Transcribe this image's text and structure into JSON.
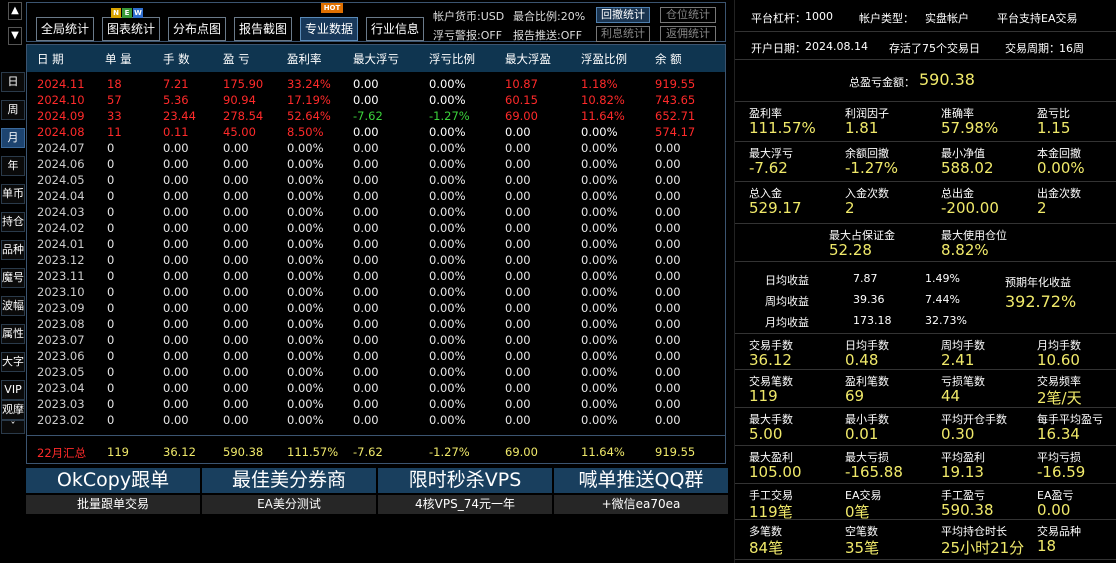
{
  "nav": {
    "up": "▲",
    "down": "▼"
  },
  "side_tabs": [
    "日",
    "周",
    "月",
    "年",
    "单币",
    "持仓",
    "品种",
    "魔号",
    "波幅",
    "属性",
    "大字",
    "VIP",
    "观摩",
    "ˇ"
  ],
  "top_buttons": [
    "全局统计",
    "图表统计",
    "分布点图",
    "报告截图",
    "专业数据",
    "行业信息"
  ],
  "badges": {
    "new": [
      "N",
      "E",
      "W"
    ],
    "hot": "HOT"
  },
  "top_labels": {
    "currency": "帐户货币:USD",
    "max_ratio": "最合比例:20%",
    "float_warn": "浮亏警报:OFF",
    "report_push": "报告推送:OFF"
  },
  "gray_buttons": [
    "回撤统计",
    "仓位统计",
    "利息统计",
    "返佣统计"
  ],
  "colors": {
    "accent": "#f0e96a",
    "red": "#ff2a2a",
    "green": "#3bd33b",
    "header_bg": "#0f3550",
    "ad_bg": "#193f5e"
  },
  "table": {
    "headers": [
      "日 期",
      "单 量",
      "手 数",
      "盈 亏",
      "盈利率",
      "最大浮亏",
      "浮亏比例",
      "最大浮盈",
      "浮盈比例",
      "余 额"
    ],
    "rows": [
      [
        "2024.11",
        "18",
        "7.21",
        "175.90",
        "33.24%",
        "0.00",
        "0.00%",
        "10.87",
        "1.18%",
        "919.55"
      ],
      [
        "2024.10",
        "57",
        "5.36",
        "90.94",
        "17.19%",
        "0.00",
        "0.00%",
        "60.15",
        "10.82%",
        "743.65"
      ],
      [
        "2024.09",
        "33",
        "23.44",
        "278.54",
        "52.64%",
        "-7.62",
        "-1.27%",
        "69.00",
        "11.64%",
        "652.71"
      ],
      [
        "2024.08",
        "11",
        "0.11",
        "45.00",
        "8.50%",
        "0.00",
        "0.00%",
        "0.00",
        "0.00%",
        "574.17"
      ],
      [
        "2024.07",
        "0",
        "0.00",
        "0.00",
        "0.00%",
        "0.00",
        "0.00%",
        "0.00",
        "0.00%",
        "0.00"
      ],
      [
        "2024.06",
        "0",
        "0.00",
        "0.00",
        "0.00%",
        "0.00",
        "0.00%",
        "0.00",
        "0.00%",
        "0.00"
      ],
      [
        "2024.05",
        "0",
        "0.00",
        "0.00",
        "0.00%",
        "0.00",
        "0.00%",
        "0.00",
        "0.00%",
        "0.00"
      ],
      [
        "2024.04",
        "0",
        "0.00",
        "0.00",
        "0.00%",
        "0.00",
        "0.00%",
        "0.00",
        "0.00%",
        "0.00"
      ],
      [
        "2024.03",
        "0",
        "0.00",
        "0.00",
        "0.00%",
        "0.00",
        "0.00%",
        "0.00",
        "0.00%",
        "0.00"
      ],
      [
        "2024.02",
        "0",
        "0.00",
        "0.00",
        "0.00%",
        "0.00",
        "0.00%",
        "0.00",
        "0.00%",
        "0.00"
      ],
      [
        "2024.01",
        "0",
        "0.00",
        "0.00",
        "0.00%",
        "0.00",
        "0.00%",
        "0.00",
        "0.00%",
        "0.00"
      ],
      [
        "2023.12",
        "0",
        "0.00",
        "0.00",
        "0.00%",
        "0.00",
        "0.00%",
        "0.00",
        "0.00%",
        "0.00"
      ],
      [
        "2023.11",
        "0",
        "0.00",
        "0.00",
        "0.00%",
        "0.00",
        "0.00%",
        "0.00",
        "0.00%",
        "0.00"
      ],
      [
        "2023.10",
        "0",
        "0.00",
        "0.00",
        "0.00%",
        "0.00",
        "0.00%",
        "0.00",
        "0.00%",
        "0.00"
      ],
      [
        "2023.09",
        "0",
        "0.00",
        "0.00",
        "0.00%",
        "0.00",
        "0.00%",
        "0.00",
        "0.00%",
        "0.00"
      ],
      [
        "2023.08",
        "0",
        "0.00",
        "0.00",
        "0.00%",
        "0.00",
        "0.00%",
        "0.00",
        "0.00%",
        "0.00"
      ],
      [
        "2023.07",
        "0",
        "0.00",
        "0.00",
        "0.00%",
        "0.00",
        "0.00%",
        "0.00",
        "0.00%",
        "0.00"
      ],
      [
        "2023.06",
        "0",
        "0.00",
        "0.00",
        "0.00%",
        "0.00",
        "0.00%",
        "0.00",
        "0.00%",
        "0.00"
      ],
      [
        "2023.05",
        "0",
        "0.00",
        "0.00",
        "0.00%",
        "0.00",
        "0.00%",
        "0.00",
        "0.00%",
        "0.00"
      ],
      [
        "2023.04",
        "0",
        "0.00",
        "0.00",
        "0.00%",
        "0.00",
        "0.00%",
        "0.00",
        "0.00%",
        "0.00"
      ],
      [
        "2023.03",
        "0",
        "0.00",
        "0.00",
        "0.00%",
        "0.00",
        "0.00%",
        "0.00",
        "0.00%",
        "0.00"
      ],
      [
        "2023.02",
        "0",
        "0.00",
        "0.00",
        "0.00%",
        "0.00",
        "0.00%",
        "0.00",
        "0.00%",
        "0.00"
      ]
    ],
    "summary": [
      "22月汇总",
      "119",
      "36.12",
      "590.38",
      "111.57%",
      "-7.62",
      "-1.27%",
      "69.00",
      "11.64%",
      "919.55"
    ]
  },
  "ads": [
    {
      "big": "OkCopy跟单",
      "small": "批量跟单交易"
    },
    {
      "big": "最佳美分券商",
      "small": "EA美分测试"
    },
    {
      "big": "限时秒杀VPS",
      "small": "4核VPS_74元一年"
    },
    {
      "big": "喊单推送QQ群",
      "small": "+微信ea70ea"
    }
  ],
  "stats": {
    "leverage_label": "平台杠杆：",
    "leverage": "1000",
    "acct_type_label": "帐户类型：",
    "acct_type": "实盘帐户",
    "platform_ea": "平台支持EA交易",
    "open_date_label": "开户日期：",
    "open_date": "2024.08.14",
    "survived": "存活了75个交易日",
    "cycle_label": "交易周期：",
    "cycle": "16周",
    "total_pl_label": "总盈亏金额：",
    "total_pl": "590.38",
    "g1": [
      [
        "盈利率",
        "111.57%"
      ],
      [
        "利润因子",
        "1.81"
      ],
      [
        "准确率",
        "57.98%"
      ],
      [
        "盈亏比",
        "1.15"
      ]
    ],
    "g2": [
      [
        "最大浮亏",
        "-7.62"
      ],
      [
        "余额回撤",
        "-1.27%"
      ],
      [
        "最小净值",
        "588.02"
      ],
      [
        "本金回撤",
        "0.00%"
      ]
    ],
    "g3": [
      [
        "总入金",
        "529.17"
      ],
      [
        "入金次数",
        "2"
      ],
      [
        "总出金",
        "-200.00"
      ],
      [
        "出金次数",
        "2"
      ]
    ],
    "g4": [
      [
        "最大占保证金",
        "52.28"
      ],
      [
        "最大使用仓位",
        "8.82%"
      ]
    ],
    "income": [
      [
        "日均收益",
        "7.87",
        "1.49%"
      ],
      [
        "周均收益",
        "39.36",
        "7.44%"
      ],
      [
        "月均收益",
        "173.18",
        "32.73%"
      ]
    ],
    "annual_label": "预期年化收益",
    "annual": "392.72%",
    "g5": [
      [
        "交易手数",
        "36.12"
      ],
      [
        "日均手数",
        "0.48"
      ],
      [
        "周均手数",
        "2.41"
      ],
      [
        "月均手数",
        "10.60"
      ]
    ],
    "g6": [
      [
        "交易笔数",
        "119"
      ],
      [
        "盈利笔数",
        "69"
      ],
      [
        "亏损笔数",
        "44"
      ],
      [
        "交易频率",
        "2笔/天"
      ]
    ],
    "g7": [
      [
        "最大手数",
        "5.00"
      ],
      [
        "最小手数",
        "0.01"
      ],
      [
        "平均开仓手数",
        "0.30"
      ],
      [
        "每手平均盈亏",
        "16.34"
      ]
    ],
    "g8": [
      [
        "最大盈利",
        "105.00"
      ],
      [
        "最大亏损",
        "-165.88"
      ],
      [
        "平均盈利",
        "19.13"
      ],
      [
        "平均亏损",
        "-16.59"
      ]
    ],
    "g9": [
      [
        "手工交易",
        "119笔"
      ],
      [
        "EA交易",
        "0笔"
      ],
      [
        "手工盈亏",
        "590.38"
      ],
      [
        "EA盈亏",
        "0.00"
      ]
    ],
    "g10": [
      [
        "多笔数",
        "84笔"
      ],
      [
        "空笔数",
        "35笔"
      ],
      [
        "平均持仓时长",
        "25小时21分"
      ],
      [
        "交易品种",
        "18"
      ]
    ]
  }
}
